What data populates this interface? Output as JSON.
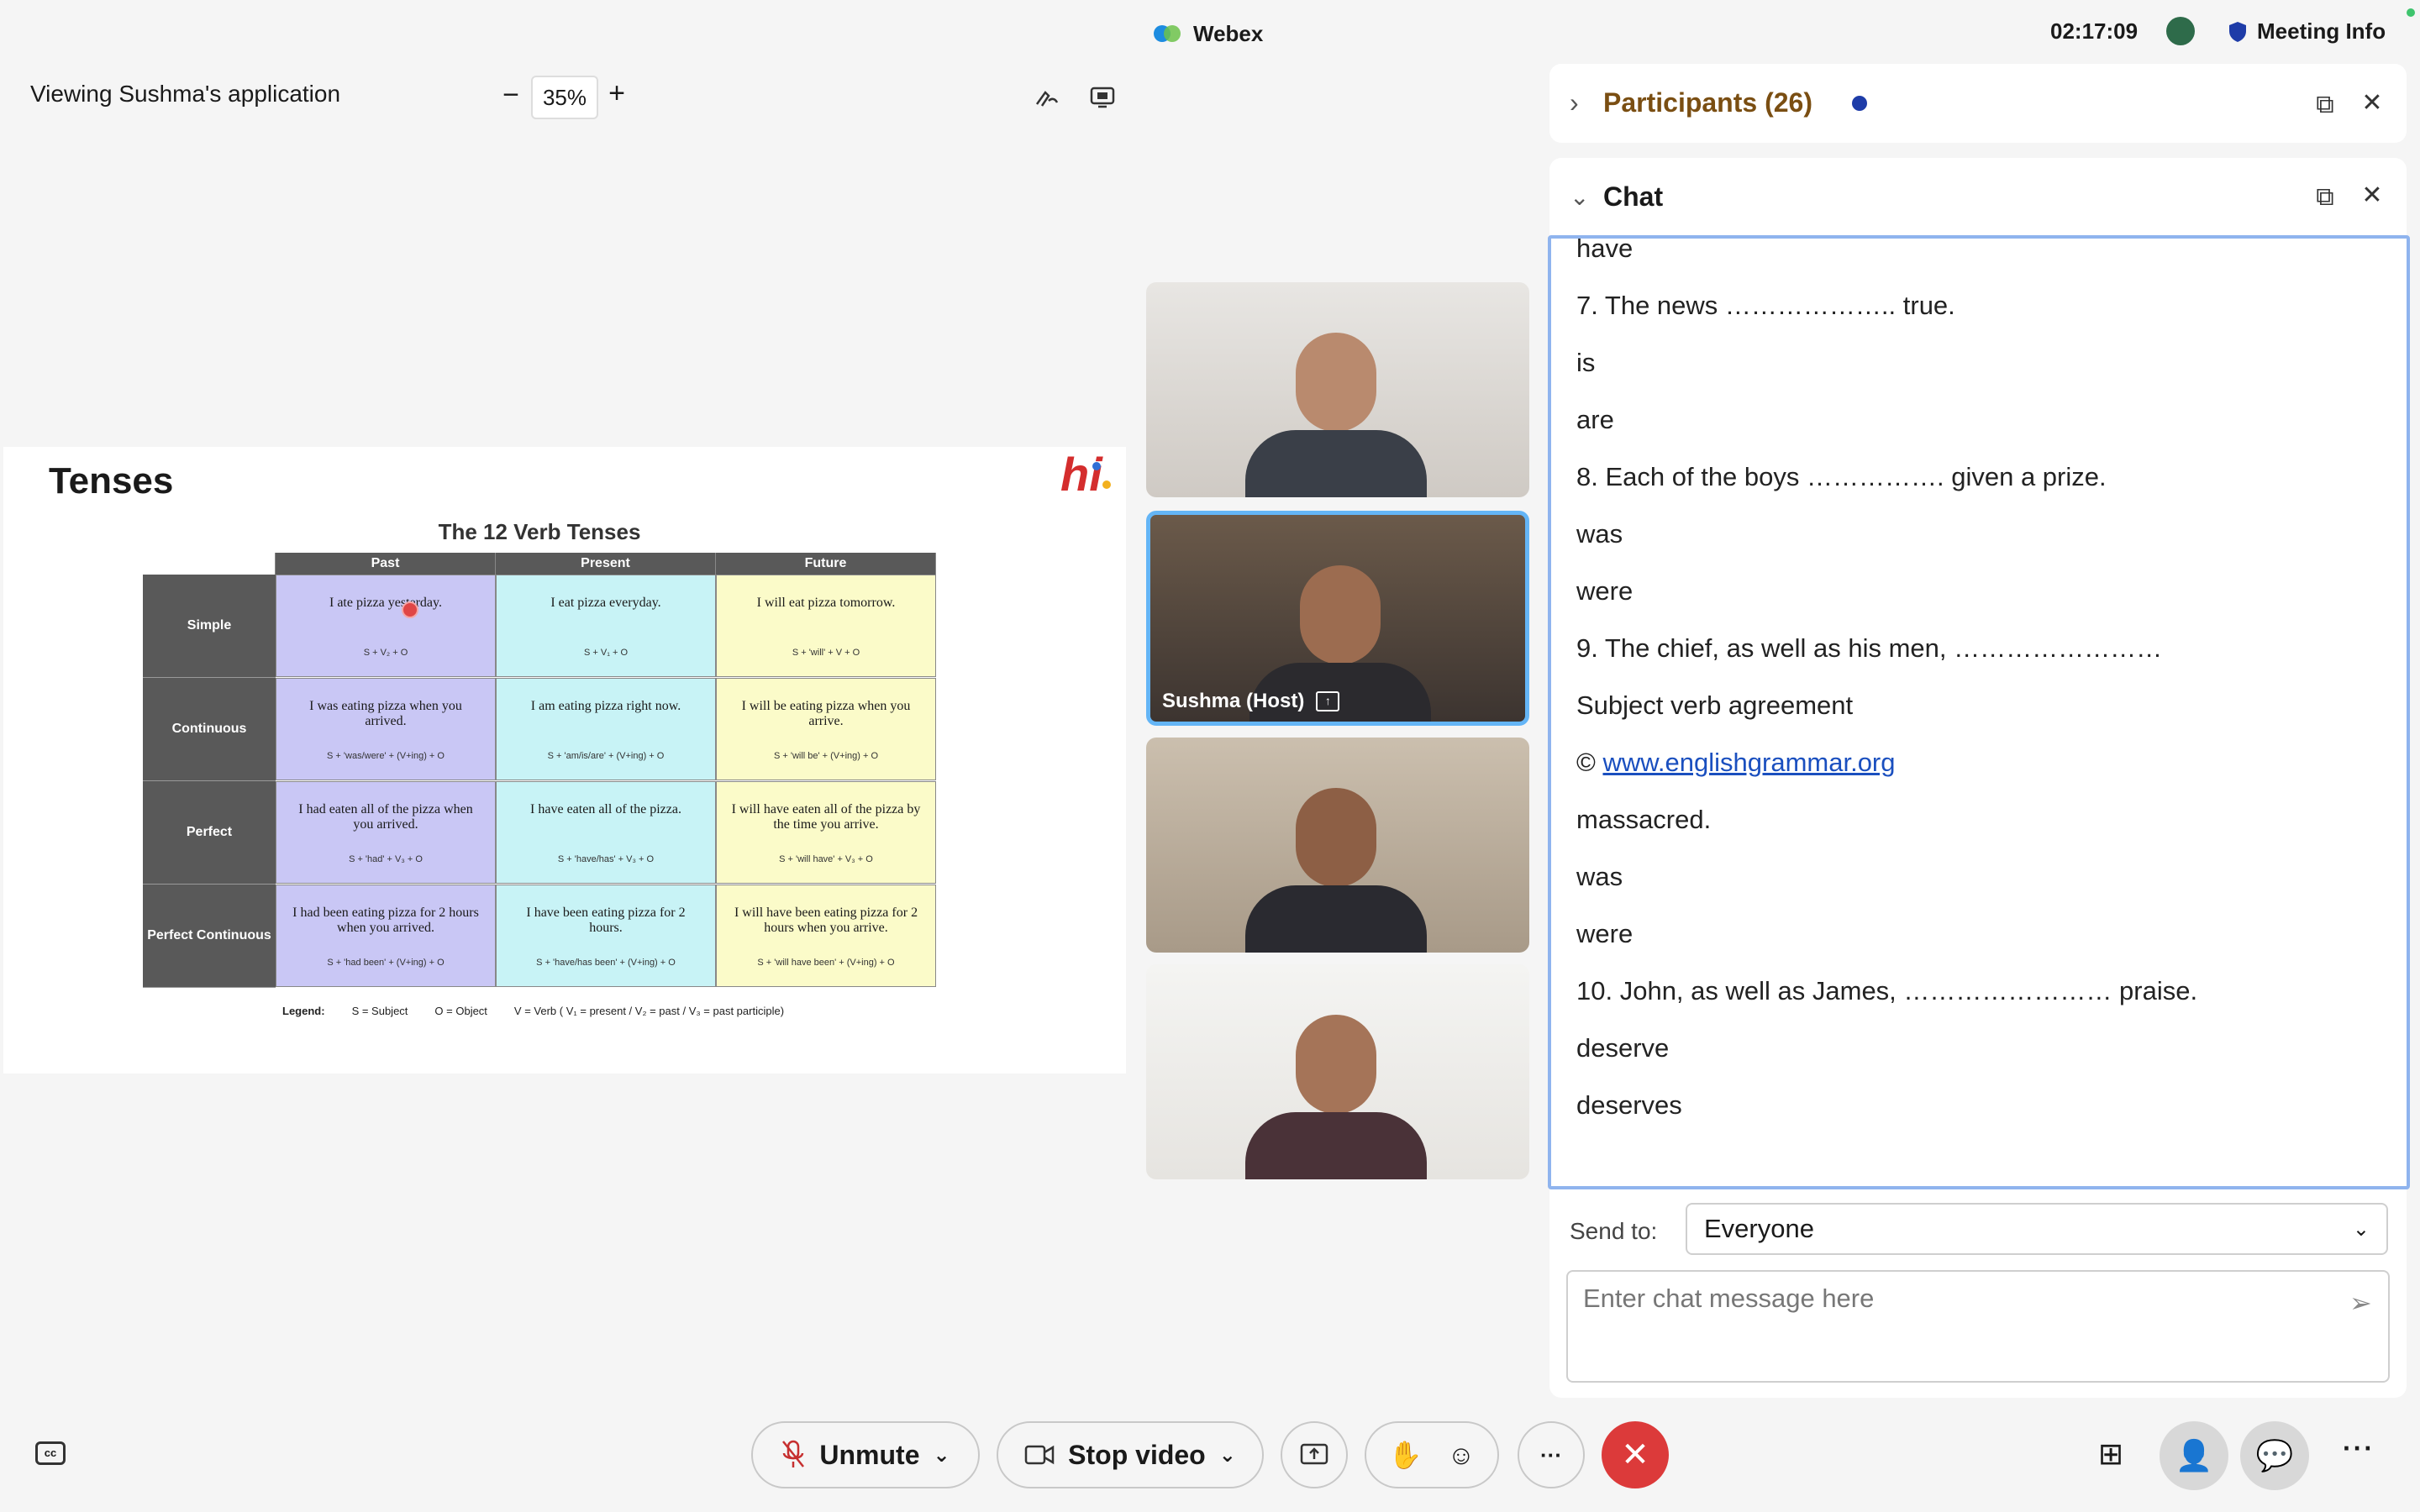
{
  "window": {
    "app_name": "Webex",
    "clock": "02:17:09",
    "meeting_info_label": "Meeting Info"
  },
  "share_toolbar": {
    "viewing_label": "Viewing Sushma's application",
    "zoom_out": "−",
    "zoom_level": "35%",
    "zoom_in": "+"
  },
  "slide": {
    "title": "Tenses",
    "logo": "hi",
    "table_title": "The 12 Verb Tenses",
    "columns": [
      "Past",
      "Present",
      "Future"
    ],
    "rows": [
      {
        "label": "Simple",
        "cells": [
          {
            "text": "I ate pizza yesterday.",
            "formula": "S + V₂ + O"
          },
          {
            "text": "I eat pizza everyday.",
            "formula": "S + V₁ + O"
          },
          {
            "text": "I will eat pizza tomorrow.",
            "formula": "S + 'will' + V + O"
          }
        ]
      },
      {
        "label": "Continuous",
        "cells": [
          {
            "text": "I was eating pizza when you arrived.",
            "formula": "S + 'was/were' + (V+ing) + O"
          },
          {
            "text": "I am eating pizza right now.",
            "formula": "S + 'am/is/are' + (V+ing) + O"
          },
          {
            "text": "I will be eating pizza when you arrive.",
            "formula": "S + 'will be' + (V+ing) + O"
          }
        ]
      },
      {
        "label": "Perfect",
        "cells": [
          {
            "text": "I had eaten all of the pizza when you arrived.",
            "formula": "S + 'had' + V₃ + O"
          },
          {
            "text": "I have eaten all of the pizza.",
            "formula": "S + 'have/has' + V₃ + O"
          },
          {
            "text": "I will have eaten all of the pizza by the time you arrive.",
            "formula": "S + 'will have' + V₃ + O"
          }
        ]
      },
      {
        "label": "Perfect Continuous",
        "cells": [
          {
            "text": "I had been eating pizza for 2 hours when you arrived.",
            "formula": "S + 'had been' + (V+ing) + O"
          },
          {
            "text": "I have been eating pizza for 2 hours.",
            "formula": "S + 'have/has been' + (V+ing) + O"
          },
          {
            "text": "I will have been eating pizza for 2 hours when you arrive.",
            "formula": "S + 'will have been' + (V+ing) + O"
          }
        ]
      }
    ],
    "legend": {
      "label": "Legend:",
      "subject": "S = Subject",
      "object": "O = Object",
      "verb": "V = Verb  ( V₁ = present  /  V₂ = past  /  V₃ = past participle)"
    }
  },
  "videos": [
    {
      "label": ""
    },
    {
      "label": "Sushma  (Host)",
      "active": true
    },
    {
      "label": ""
    },
    {
      "label": ""
    }
  ],
  "participants_panel": {
    "title": "Participants (26)"
  },
  "chat_panel": {
    "title": "Chat",
    "messages": [
      {
        "text": "have"
      },
      {
        "text": "7. The news ……………….. true."
      },
      {
        "text": "is"
      },
      {
        "text": "are"
      },
      {
        "text": "8. Each of the boys ……………. given a prize."
      },
      {
        "text": "was"
      },
      {
        "text": "were"
      },
      {
        "text": "9. The chief, as well as his men, ……………………"
      },
      {
        "text": "Subject verb agreement"
      },
      {
        "text": "© ",
        "link": "www.englishgrammar.org"
      },
      {
        "text": "massacred."
      },
      {
        "text": "was"
      },
      {
        "text": "were"
      },
      {
        "text": "10. John, as well as James, …………………… praise."
      },
      {
        "text": "deserve"
      },
      {
        "text": "deserves"
      }
    ],
    "send_to_label": "Send to:",
    "send_to_value": "Everyone",
    "input_placeholder": "Enter chat message here"
  },
  "controls": {
    "unmute_label": "Unmute",
    "video_label": "Stop video",
    "more_label": "···"
  },
  "colors": {
    "past": "#c9c7f5",
    "present": "#c8f3f6",
    "future": "#fbfbc9",
    "leave": "#dc3a3a",
    "participants_title": "#7a4e12",
    "active_tile_border": "#64b5f6"
  }
}
